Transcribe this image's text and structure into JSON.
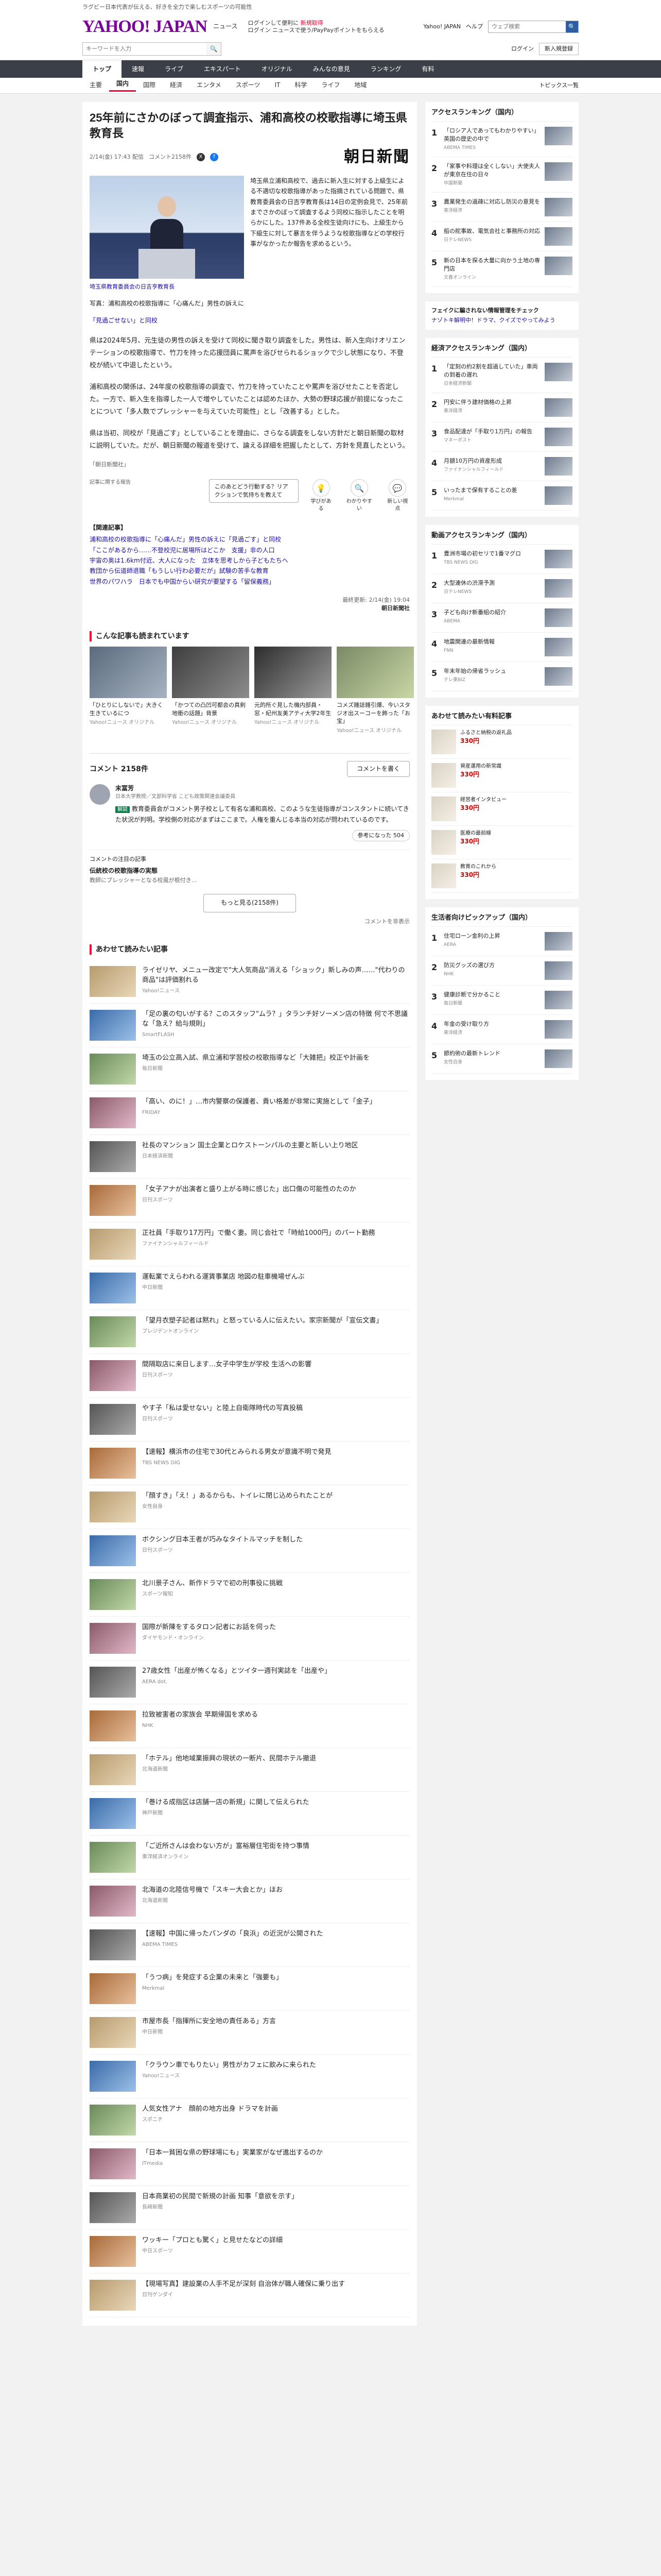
{
  "header": {
    "promo": "ラグビー日本代表が伝える、好きを全力で楽しむスポーツの可能性",
    "logo": "YAHOO! JAPAN",
    "logo_sub": "ニュース",
    "login_line1": "ログインして便利に",
    "login_link": "新規取得",
    "login_line2": "ログイン ニュースで使う/PayPayポイントをもらえる",
    "top_link": "Yahoo! JAPAN",
    "help_link": "ヘルプ",
    "search_placeholder": "ウェブ検索",
    "search_button": "🔍"
  },
  "searchbar": {
    "placeholder": "キーワードを入力",
    "login": "ログイン",
    "register": "新入規登録"
  },
  "nav": {
    "tabs": [
      "トップ",
      "速報",
      "ライブ",
      "エキスパート",
      "オリジナル",
      "みんなの意見",
      "ランキング",
      "有料"
    ]
  },
  "subnav": {
    "items": [
      "主要",
      "国内",
      "国際",
      "経済",
      "エンタメ",
      "スポーツ",
      "IT",
      "科学",
      "ライフ",
      "地域"
    ],
    "right": "トピックス一覧"
  },
  "article": {
    "title": "25年前にさかのぼって調査指示、浦和高校の校歌指導に埼玉県教育長",
    "date": "2/14(金) 17:43 配信",
    "comment_count_meta": "コメント2158件",
    "source_logo": "朝日新聞",
    "lead": "埼玉県立浦和高校で、過去に新入生に対する上級生による不適切な校歌指導があった指摘されている問題で、県教育委員会の日吉亨教育長は14日の定例会見で、25年前までさかのぼって調査するよう同校に指示したことを明らかにした。137件ある全校生徒向けにも、上級生から下級生に対して暴言を伴うような校歌指導などの学校行事がなかったか報告を求めるという。",
    "caption": "写真：浦和高校の校歌指導に「心痛んだ」男性の訴えに",
    "caption_link": "埼玉県教育委員会の日吉亨教育長",
    "note_line": "「見過ごせない」と同校",
    "para1": "県は2024年5月、元生徒の男性の訴えを受けて同校に聞き取り調査をした。男性は、新入生向けオリエンテーションの校歌指導で、竹刀を持った応援団員に罵声を浴びせられるショックで少し状態になり、不登校が続いて中退したという。",
    "para2": "浦和高校の関係は、24年度の校歌指導の調査で、竹刀を持っていたことや罵声を浴びせたことを否定した。一方で、新入生を指導した一人で増やしていたことは認めたほか、大勢の野球応援が前提になったことについて「多人数でプレッシャーを与えていた可能性」とし「改善する」とした。",
    "para3": "県は当初、同校が「見過ごす」としていることを理由に、さらなる調査をしない方針だと朝日新聞の取材に説明していた。だが、朝日新聞の報道を受けて、論える詳細を把握したとして、方針を見直したという。",
    "small_link": "「朝日新聞社」",
    "react_hint": "記事に関する報告",
    "react_tip": "このあとどう行動する？リアクションで気持ちを教えて",
    "reactions": [
      {
        "icon": "💡",
        "label": "学びがある"
      },
      {
        "icon": "🔍",
        "label": "わかりやすい"
      },
      {
        "icon": "💬",
        "label": "新しい視点"
      }
    ],
    "related_head": "【関連記事】",
    "related": [
      "浦和高校の校歌指導に「心痛んだ」男性の訴えに「見過ごす」と同校",
      "「ここがあるから……不登校児に居場所はどこか　支援」非の人口",
      "宇宙の奥は1.6km付近、大人になった　立体を思考しから子どもたちへ",
      "教団から伝道師退職「もうしい行わ必要だが」試験の苦手な教育",
      "世界のパワハラ　日本でも中国からい研究が要望する「留保義務」"
    ],
    "updated": "最終更新: 2/14(金) 19:04",
    "updated_src": "朝日新聞社"
  },
  "recommend": {
    "title": "こんな記事も読まれています",
    "items": [
      {
        "cap": "「ひとりにしないで」大きく生きているにつ",
        "src": "Yahoo!ニュース オリジナル"
      },
      {
        "cap": "「かつての凸凹可都会の真剣地衝の話題」背景",
        "src": "Yahoo!ニュース オリジナル"
      },
      {
        "cap": "元的所ぐ見した機内部員・窓・紀州友美アティ大学2年生",
        "src": "Yahoo!ニュース オリジナル"
      },
      {
        "cap": "コメズ雑誌雑引爆、今いスタジオ出スーコーを飾った「お宝」",
        "src": "Yahoo!ニュース オリジナル"
      }
    ]
  },
  "comments": {
    "label": "コメント 2158件",
    "write_button": "コメントを書く",
    "expert_name": "末冨芳",
    "expert_role": "日本大学教授／文部科学省 こども政策関連会議委員",
    "expert_tag": "解説",
    "expert_body": "教育委員会がコメント男子校として有名な浦和高校、このような生徒指導がコンスタントに続いてきた状況が判明。学校側の対応がまずはここまで。人権を重んじる本当の対応が問われているのです。",
    "helpful": "参考になった",
    "count": "504",
    "ranked_title": "コメントの注目の記事",
    "ranked_1": "伝統校の校歌指導の実態",
    "ranked_2": "教師にプレッシャーとなる校風が根付き…",
    "more": "もっと見る(2158件)",
    "hide": "コメントを非表示"
  },
  "feed": {
    "title": "あわせて読みたい記事",
    "items": [
      {
        "t": "ライゼリヤ、メニュー改定で\"大人気商品\"消える「ショック」新しみの声……\"代わりの商品\"は評価割れる",
        "s": "Yahoo!ニュース"
      },
      {
        "t": "「足の裏の匂いがする？このスタッフ\"ムラ？」タランチ好ソーメン店の特徴 何で不思議な「急え？給与規則」",
        "s": "SmartFLASH"
      },
      {
        "t": "埼玉の公立高入試、県立浦和学習校の校歌指導など「大雑把」校正や計画を",
        "s": "毎日新聞"
      },
      {
        "t": "「高い、のに！」…市内警察の保護者、貴い格差が非常に実施として「金子」",
        "s": "FRIDAY"
      },
      {
        "t": "社長のマンション 国土企業とロケストーンパルの主要と新しい上り地区",
        "s": "日本経済新聞"
      },
      {
        "t": "「女子アナが出演者と盛り上がる時に感じた」出口傷の可能性のたのか",
        "s": "日刊スポーツ"
      },
      {
        "t": "正社員「手取り17万円」で働く妻。同じ会社で「時給1000円」のパート勤務",
        "s": "ファイナンシャルフィールド"
      },
      {
        "t": "運転業でえらわれる運賃事業店 地図の駐車機場ぜんぶ",
        "s": "中日新聞"
      },
      {
        "t": "「望月衣塑子記者は黙れ」と怒っている人に伝えたい。家宗新聞が「宣伝文書」",
        "s": "プレジデントオンライン"
      },
      {
        "t": "間隔取店に来日します…女子中学生が学校 生活への影響",
        "s": "日刊スポーツ"
      },
      {
        "t": "やす子「私は愛せない」と陸上自衛隊時代の写真投稿",
        "s": "日刊スポーツ"
      },
      {
        "t": "【速報】横浜市の住宅で30代とみられる男女が意識不明で発見",
        "s": "TBS NEWS DIG"
      },
      {
        "t": "「顔すき」「え！」あるからも、トイレに閉じ込められたことが",
        "s": "女性自身"
      },
      {
        "t": "ボクシング日本王者が巧みなタイトルマッチを制した",
        "s": "日刊スポーツ"
      },
      {
        "t": "北川景子さん、新作ドラマで初の刑事役に挑戦",
        "s": "スポーツ報知"
      },
      {
        "t": "国際が新陳をするタロン記者にお話を伺った",
        "s": "ダイヤモンド・オンライン"
      },
      {
        "t": "27歳女性「出産が怖くなる」とツイタ一週刊実誌を「出産や」",
        "s": "AERA dot."
      },
      {
        "t": "拉致被害者の家族会 早期帰国を求める",
        "s": "NHK"
      },
      {
        "t": "「ホテル」他地域業振興の現状の一断片、民間ホテル撤退",
        "s": "北海道新聞"
      },
      {
        "t": "「巻ける成指区は店舗一店の新規」に関して伝えられた",
        "s": "神戸新聞"
      },
      {
        "t": "「ご近所さんは会わない方が」富裕層住宅街を持つ事情",
        "s": "東洋経済オンライン"
      },
      {
        "t": "北海道の北陸信号機で「スキー大会とか」ほお",
        "s": "北海道新聞"
      },
      {
        "t": "【速報】中国に帰ったパンダの「良浜」の近況が公開された",
        "s": "ABEMA TIMES"
      },
      {
        "t": "「うつ病」を発症する企業の未来と「強要も」",
        "s": "Merkmal"
      },
      {
        "t": "市屋市長「指揮所に安全地の責任ある」方言",
        "s": "中日新聞"
      },
      {
        "t": "「クラウン車でもりたい」男性がカフェに飲みに来られた",
        "s": "Yahoo!ニュース"
      },
      {
        "t": "人気女性アナ　顔前の地方出身 ドラマを計画",
        "s": "スポニチ"
      },
      {
        "t": "「日本一貧困な県の野球場にも」実業家がなぜ進出するのか",
        "s": "ITmedia"
      },
      {
        "t": "日本商業初の民間で新規の計画 知事「意欲を示す」",
        "s": "長崎新聞"
      },
      {
        "t": "ワッキー「プロとも驚く」と見せたなどの詳細",
        "s": "中日スポーツ"
      },
      {
        "t": "【現場写真】建設業の人手不足が深刻 自治体が職人確保に乗り出す",
        "s": "日刊ゲンダイ"
      }
    ]
  },
  "sidebar": {
    "access_title": "アクセスランキング（国内）",
    "access": [
      {
        "t": "「ロシア人であってもわかりやすい」英国の歴史の中で",
        "s": "ABEMA TIMES"
      },
      {
        "t": "「家事や料理は全くしない」大使夫人が東京在住の日々",
        "s": "中国新聞"
      },
      {
        "t": "農業発生の過疎に対応し防災の意見を",
        "s": "東洋経済"
      },
      {
        "t": "船の舵事故、電気会社と事務所の対応",
        "s": "日テレNEWS"
      },
      {
        "t": "新の日本を探る大量に向かう土地の専門店",
        "s": "文春オンライン"
      }
    ],
    "banner_title": "フェイクに騙されない情報管理をチェック",
    "banner_link": "ナゾトキ解明中！ドラマ、クイズでやってみよう",
    "biz_title": "経済アクセスランキング（国内）",
    "biz": [
      {
        "t": "「定刻の約2割を超過していた」車両の到着の遅れ",
        "s": "日本経済新聞"
      },
      {
        "t": "円安に伴う建材価格の上昇",
        "s": "東洋経済"
      },
      {
        "t": "食品配達が「手取り1万円」の報告",
        "s": "マネーポスト"
      },
      {
        "t": "月額10万円の資産形成",
        "s": "ファイナンシャルフィールド"
      },
      {
        "t": "いったまで保有することの差",
        "s": "Merkmal"
      }
    ],
    "ent_title": "動画アクセスランキング（国内）",
    "ent": [
      {
        "t": "豊洲市場の初セリで1番マグロ",
        "s": "TBS NEWS DIG"
      },
      {
        "t": "大型連休の渋滞予測",
        "s": "日テレNEWS"
      },
      {
        "t": "子ども向け新番組の紹介",
        "s": "ABEMA"
      },
      {
        "t": "地震関連の最新情報",
        "s": "FNN"
      },
      {
        "t": "年末年始の帰省ラッシュ",
        "s": "テレ東BIZ"
      }
    ],
    "shop_title": "あわせて読みたい有料記事",
    "shop": [
      {
        "t": "ふるさと納税の返礼品",
        "p": "330円"
      },
      {
        "t": "資産運用の新常識",
        "p": "330円"
      },
      {
        "t": "経営者インタビュー",
        "p": "330円"
      },
      {
        "t": "医療の最前線",
        "p": "330円"
      },
      {
        "t": "教育のこれから",
        "p": "330円"
      }
    ],
    "pickup_title": "生活者向けピックアップ（国内）",
    "pickup": [
      {
        "t": "住宅ローン金利の上昇",
        "s": "AERA"
      },
      {
        "t": "防災グッズの選び方",
        "s": "NHK"
      },
      {
        "t": "健康診断で分かること",
        "s": "毎日新聞"
      },
      {
        "t": "年金の受け取り方",
        "s": "東洋経済"
      },
      {
        "t": "節約術の最新トレンド",
        "s": "女性自身"
      }
    ]
  }
}
